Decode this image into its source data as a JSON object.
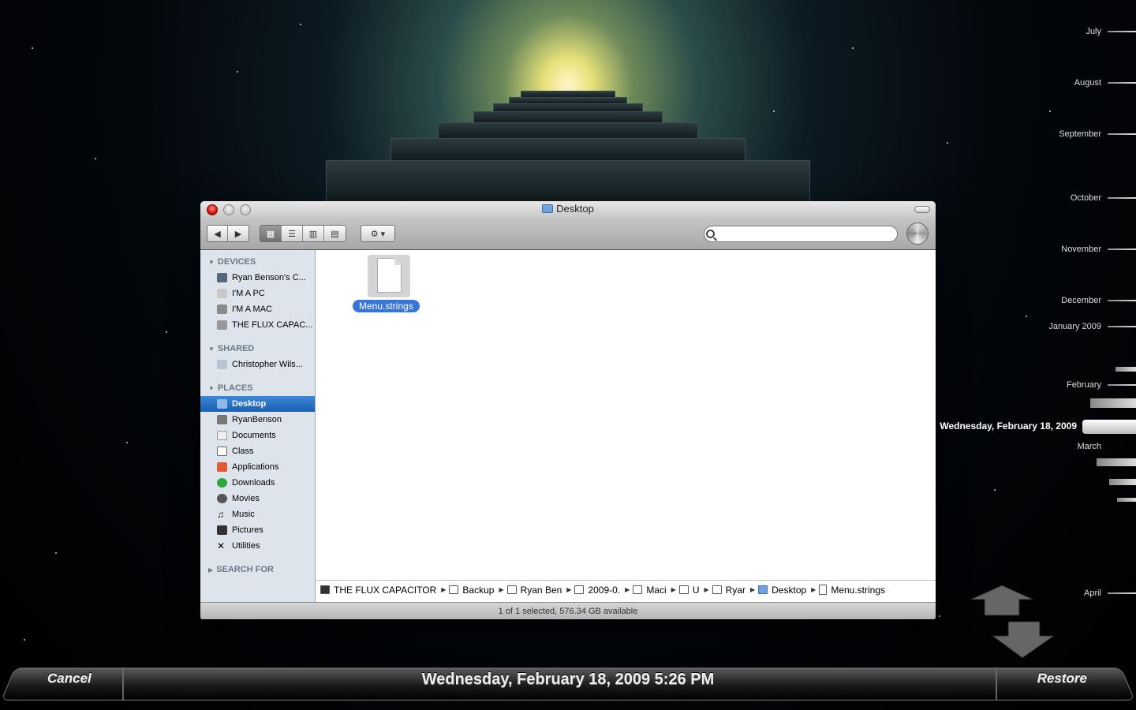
{
  "finder": {
    "title": "Desktop",
    "sidebar": {
      "devices_header": "DEVICES",
      "devices": [
        "Ryan Benson's C...",
        "I'M A PC",
        "I'M A MAC",
        "THE FLUX CAPAC..."
      ],
      "shared_header": "SHARED",
      "shared": [
        "Christopher Wils..."
      ],
      "places_header": "PLACES",
      "places": [
        "Desktop",
        "RyanBenson",
        "Documents",
        "Class",
        "Applications",
        "Downloads",
        "Movies",
        "Music",
        "Pictures",
        "Utilities"
      ],
      "search_header": "SEARCH FOR"
    },
    "file": {
      "name": "Menu.strings"
    },
    "path": [
      "THE FLUX CAPACITOR",
      "Backup",
      "Ryan Ben",
      "2009-0.",
      "Maci",
      "U",
      "Ryar",
      "Desktop",
      "Menu.strings"
    ],
    "status": "1 of 1 selected, 576.34 GB available"
  },
  "timeline": {
    "labels": [
      "July",
      "August",
      "September",
      "October",
      "November",
      "December",
      "January 2009",
      "February",
      "March",
      "April"
    ],
    "current": "Wednesday, February 18, 2009"
  },
  "bottombar": {
    "cancel": "Cancel",
    "date": "Wednesday, February 18, 2009 5:26 PM",
    "restore": "Restore"
  }
}
